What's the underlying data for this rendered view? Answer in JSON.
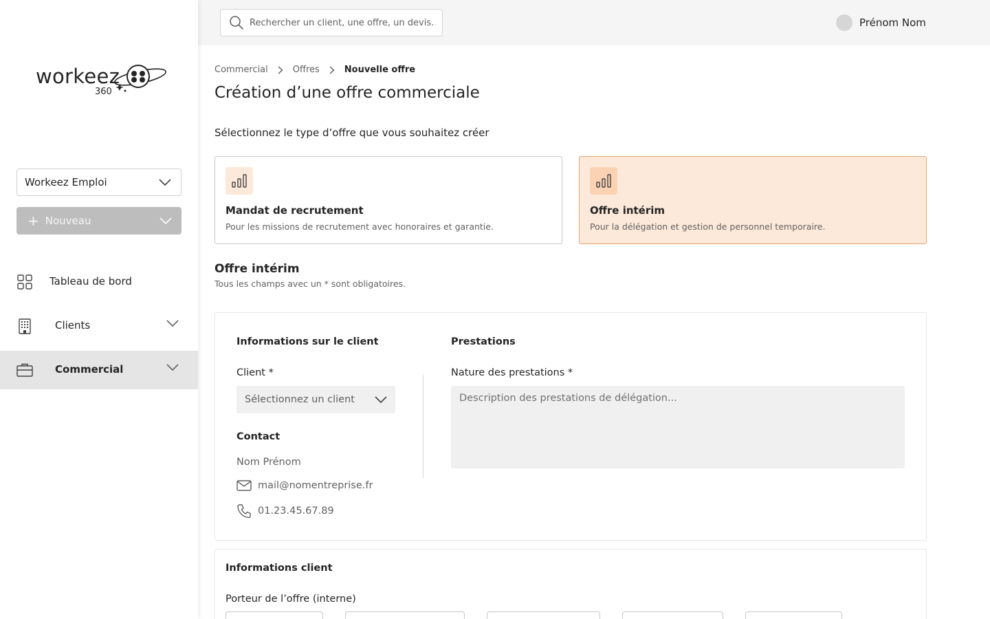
{
  "app": {
    "logo_text": "workeez",
    "logo_sub": "360"
  },
  "search": {
    "placeholder": "Rechercher un client, une offre, un devis..."
  },
  "user": {
    "name": "Prénom Nom"
  },
  "sidebar": {
    "org_select": "Workeez Emploi",
    "new_button": "Nouveau",
    "items": [
      {
        "label": "Tableau de bord",
        "icon": "grid-icon"
      },
      {
        "label": "Clients",
        "icon": "building-icon"
      },
      {
        "label": "Commercial",
        "icon": "briefcase-icon",
        "active": true
      }
    ]
  },
  "breadcrumb": [
    "Commercial",
    "Offres",
    "Nouvelle offre"
  ],
  "page": {
    "title": "Création d’une offre commerciale",
    "select_prompt": "Sélectionnez le type d’offre que vous souhaitez créer"
  },
  "offer_types": [
    {
      "title": "Mandat de recrutement",
      "description": "Pour les missions de recrutement avec honoraires et garantie.",
      "selected": false
    },
    {
      "title": "Offre intérim",
      "description": "Pour la délégation et gestion de personnel temporaire.",
      "selected": true
    }
  ],
  "form": {
    "title": "Offre intérim",
    "required_note": "Tous les champs avec un * sont obligatoires.",
    "client_info": {
      "heading": "Informations sur le client",
      "client_label": "Client *",
      "client_placeholder": "Sélectionnez un client",
      "contact_heading": "Contact",
      "contact_name": "Nom Prénom",
      "contact_email": "mail@nomentreprise.fr",
      "contact_phone": "01.23.45.67.89"
    },
    "services": {
      "heading": "Prestations",
      "nature_label": "Nature des prestations *",
      "nature_placeholder": "Description des prestations de délégation..."
    }
  },
  "client_details": {
    "heading": "Informations client",
    "owner_label": "Porteur de l’offre (interne)"
  },
  "colors": {
    "accent_bg": "#fde9d9",
    "accent_border": "#e8a26a",
    "sidebar_active": "#e5e5e5",
    "disabled_button": "#bdbdbd"
  }
}
